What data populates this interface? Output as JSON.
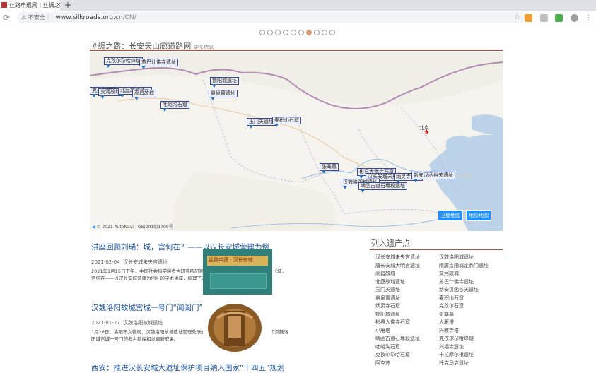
{
  "browser": {
    "tab_title": "丝路申遗网 | 丝绸之路：长安-天山廊道",
    "tab_close": "×",
    "new_tab": "+",
    "security_label": "不安全",
    "url_host": "www.silkroads.org.cn",
    "url_path": "/CN/"
  },
  "carousel": {
    "count": 10,
    "active_index": 6
  },
  "map_section": {
    "title": "#绸之路：长安天山廊道路网",
    "more": "更多信息",
    "capital_label": "北京",
    "btn_satellite": "卫星地图",
    "btn_terrain": "地形地图",
    "footer": "© 2021 AutoNavi - GS(2019)1709号",
    "sites": [
      "克孜尔尕哈烽燧",
      "苏巴什佛寺遗址",
      "克孜尔石窟",
      "交河故城",
      "北庭故城遗址",
      "高昌故城",
      "吐峪沟石窟",
      "锁阳城遗址",
      "悬泉置遗址",
      "玉门关遗址",
      "麦积山石窟",
      "张骞墓",
      "彬县大佛寺石窟",
      "汉长安城未央宫遗址",
      "汉魏洛阳城遗址",
      "崤函古道石壕段遗址",
      "炳灵寺石窟",
      "新安汉函谷关遗址"
    ]
  },
  "news": [
    {
      "title": "讲座回顾刘瑞：城，宫何在？——以汉长安城营建为例",
      "date": "2021-02-04",
      "source": "汉长安城未央宫遗址",
      "body": "2021年1月15日下午，中国社会科学院考古研究所研究员刘瑞在陕西历史博物馆作了题为《城，宫何在——以汉长安城营建为例》的学术讲座，梳理了汉长安城考古研究的新进展。"
    },
    {
      "title": "汉魏洛阳故城宫城一号门“阊阖门”之谜逐步揭开",
      "date": "2021-01-27",
      "source": "汉魏洛阳故城遗址",
      "body": "1月26日，洛阳市文物局、汉魏洛阳故城遗址管理处联合中国社会科学院考古研究所公布了汉魏洛阳城宫城一号门的考古勘探和发掘新成果。"
    },
    {
      "title": "西安：推进汉长安城大遗址保护项目纳入国家“十四五”规划",
      "date": "",
      "source": "",
      "body": ""
    }
  ],
  "news_images": [
    {
      "caption": "丝路申遗 · 汉长安城"
    },
    {
      "caption": ""
    }
  ],
  "sidebar": {
    "title": "列入遗产点",
    "items": [
      "汉长安城未央宫遗址",
      "汉魏洛阳城遗址",
      "唐长安城大明宫遗址",
      "隋唐洛阳城定鼎门遗址",
      "高昌故城",
      "交河故城",
      "北庭故城遗址",
      "苏巴什佛寺遗址",
      "玉门关遗址",
      "新安汉函谷关遗址",
      "悬泉置遗址",
      "麦积山石窟",
      "炳灵寺石窟",
      "克孜尔石窟",
      "锁阳城遗址",
      "张骞墓",
      "彬县大佛寺石窟",
      "大雁塔",
      "小雁塔",
      "兴教寺塔",
      "崤函古道石壕段遗址",
      "克孜尔尕哈烽燧",
      "吐峪沟石窟",
      "兴福寺遗址",
      "克孜尔尕哈石窟",
      "卡拉摩尔根遗址",
      "阿克苏",
      "托克马克遗址"
    ]
  }
}
